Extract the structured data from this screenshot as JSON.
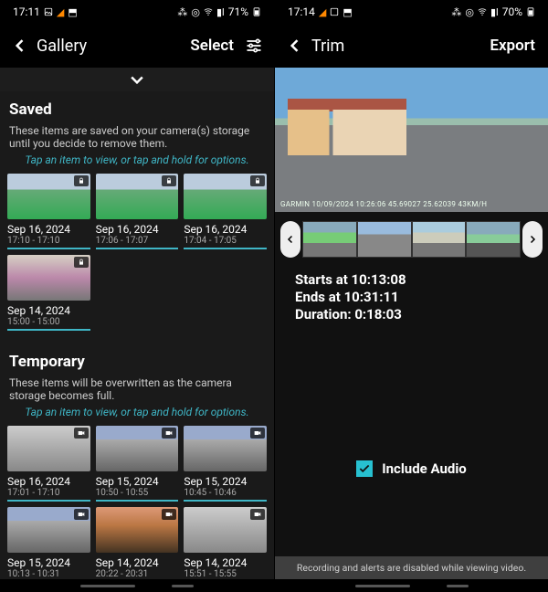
{
  "left": {
    "status": {
      "time": "17:11",
      "battery": "71%"
    },
    "appbar": {
      "title": "Gallery",
      "action": "Select"
    },
    "saved": {
      "heading": "Saved",
      "desc": "These items are saved on your camera(s) storage until you decide to remove them.",
      "tip": "Tap an item to view, or tap and hold for options.",
      "items": [
        {
          "date": "Sep 16, 2024",
          "time": "17:10 - 17:10"
        },
        {
          "date": "Sep 16, 2024",
          "time": "17:06 - 17:07"
        },
        {
          "date": "Sep 16, 2024",
          "time": "17:04 - 17:05"
        },
        {
          "date": "Sep 14, 2024",
          "time": "15:00 - 15:00"
        }
      ]
    },
    "temp": {
      "heading": "Temporary",
      "desc": "These items will be overwritten as the camera storage becomes full.",
      "tip": "Tap an item to view, or tap and hold for options.",
      "items": [
        {
          "date": "Sep 16, 2024",
          "time": "17:01 - 17:10"
        },
        {
          "date": "Sep 15, 2024",
          "time": "10:50 - 10:55"
        },
        {
          "date": "Sep 15, 2024",
          "time": "10:45 - 10:46"
        },
        {
          "date": "Sep 15, 2024",
          "time": "10:13 - 10:31"
        },
        {
          "date": "Sep 14, 2024",
          "time": "20:22 - 20:31"
        },
        {
          "date": "Sep 14, 2024",
          "time": "15:51 - 15:55"
        }
      ]
    }
  },
  "right": {
    "status": {
      "time": "17:14",
      "battery": "70%"
    },
    "appbar": {
      "title": "Trim",
      "action": "Export"
    },
    "watermark": "GARMIN  10/09/2024 10:26:06  45.69027  25.62039  43KM/H",
    "starts_label": "Starts at ",
    "starts": "10:13:08",
    "ends_label": "Ends at ",
    "ends": "10:31:11",
    "duration_label": "Duration: ",
    "duration": "0:18:03",
    "include_audio": "Include Audio",
    "banner": "Recording and alerts are disabled while viewing video."
  }
}
